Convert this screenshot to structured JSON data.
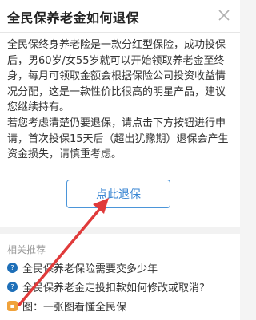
{
  "dialog": {
    "title": "全民保养老金如何退保",
    "close_icon": "close-icon",
    "body_paragraph_1": "全民保终身养老险是一款分红型保险，成功投保后，男60岁/女55岁就可以开始领取养老金至终身，每月可领取金额会根据保险公司投资收益情况分配，这是一款性价比很高的明星产品，建议您继续持有。",
    "body_paragraph_2": "若您考虑清楚仍要退保，请点击下方按钮进行申请，首次投保15天后（超出犹豫期）退保会产生资金损失，请慎重考虑。",
    "button_label": "点此退保"
  },
  "related": {
    "title": "相关推荐",
    "items": [
      {
        "label": "全民保养老保险需要交多少年",
        "icon": "question-icon"
      },
      {
        "label": "全民保养老金定投扣款如何修改或取消?",
        "icon": "question-icon"
      },
      {
        "label": "图：一张图看懂全民保",
        "icon": "image-icon"
      }
    ]
  },
  "colors": {
    "accent": "#3a86d3",
    "annotation_arrow": "#e03a3a"
  }
}
